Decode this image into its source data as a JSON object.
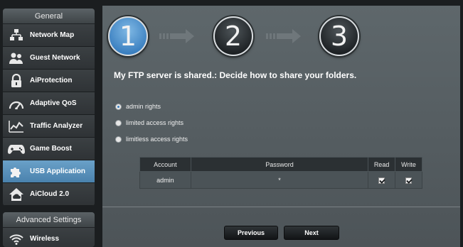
{
  "sidebar": {
    "general_header": "General",
    "items": [
      {
        "label": "Network Map",
        "icon": "network-map-icon",
        "active": false
      },
      {
        "label": "Guest Network",
        "icon": "guest-network-icon",
        "active": false
      },
      {
        "label": "AiProtection",
        "icon": "lock-icon",
        "active": false
      },
      {
        "label": "Adaptive QoS",
        "icon": "speedometer-icon",
        "active": false
      },
      {
        "label": "Traffic Analyzer",
        "icon": "traffic-chart-icon",
        "active": false
      },
      {
        "label": "Game Boost",
        "icon": "gamepad-icon",
        "active": false
      },
      {
        "label": "USB Application",
        "icon": "puzzle-icon",
        "active": true
      },
      {
        "label": "AiCloud 2.0",
        "icon": "cloud-house-icon",
        "active": false
      }
    ],
    "advanced_header": "Advanced Settings",
    "advanced_items": [
      {
        "label": "Wireless",
        "icon": "wifi-icon"
      }
    ]
  },
  "wizard": {
    "steps": [
      "1",
      "2",
      "3"
    ],
    "current_step": 1,
    "title": "My FTP server is shared.: Decide how to share your folders.",
    "options": [
      {
        "label": "admin rights",
        "checked": true
      },
      {
        "label": "limited access rights",
        "checked": false
      },
      {
        "label": "limitless access rights",
        "checked": false
      }
    ],
    "table": {
      "headers": {
        "account": "Account",
        "password": "Password",
        "read": "Read",
        "write": "Write"
      },
      "rows": [
        {
          "account": "admin",
          "password": "*",
          "read": true,
          "write": true
        }
      ]
    },
    "buttons": {
      "previous": "Previous",
      "next": "Next"
    }
  },
  "colors": {
    "accent": "#4a82ad",
    "panel": "#565e62",
    "background": "#1b1e20"
  }
}
